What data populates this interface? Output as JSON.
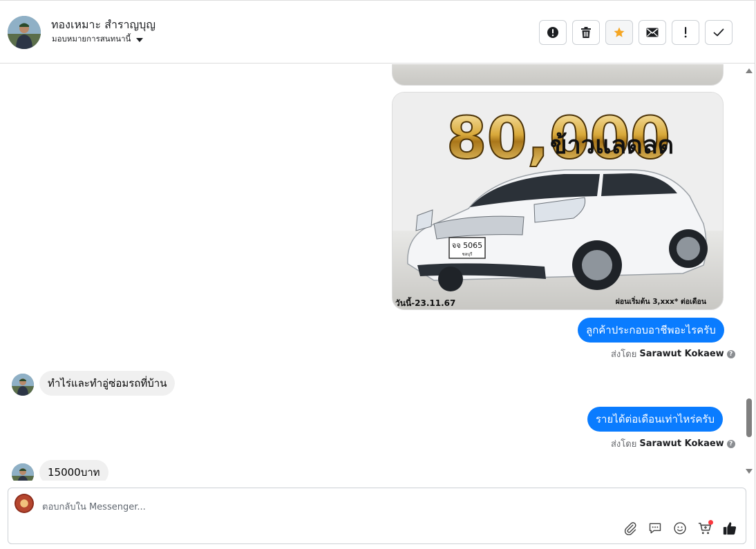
{
  "header": {
    "contact_name": "ทองเหมาะ สำราญบุญ",
    "assign_label": "มอบหมายการสนทนานี้"
  },
  "actions": [
    {
      "id": "spam",
      "icon": "alert-circle-icon"
    },
    {
      "id": "delete",
      "icon": "trash-icon"
    },
    {
      "id": "star",
      "icon": "star-icon",
      "color": "#f5a623"
    },
    {
      "id": "unread",
      "icon": "mail-icon"
    },
    {
      "id": "follow_up",
      "icon": "exclamation-icon"
    },
    {
      "id": "done",
      "icon": "check-icon"
    }
  ],
  "image_post": {
    "headline_number": "80,000",
    "headline_text": "ข้าวแลดลด",
    "plate": "จจ 5065",
    "plate_province": "ชลบุรี",
    "date_stamp": "วันนี้-23.11.67",
    "installment": "ผ่อนเริ่มต้น 3,xxx* ต่อเดือน",
    "car_color": "#f4f5f7"
  },
  "messages": [
    {
      "direction": "out",
      "text": "ลูกค้าประกอบอาชีพอะไรครับ",
      "sent_by_prefix": "ส่งโดย",
      "sender": "Sarawut Kokaew"
    },
    {
      "direction": "in",
      "text": "ทำไร่และทำอู่ซ่อมรถที่บ้าน"
    },
    {
      "direction": "out",
      "text": "รายได้ต่อเดือนเท่าไหร่ครับ",
      "sent_by_prefix": "ส่งโดย",
      "sender": "Sarawut Kokaew"
    },
    {
      "direction": "in",
      "text": "15000บาท"
    }
  ],
  "composer": {
    "placeholder": "ตอบกลับใน Messenger...",
    "tools": [
      "paperclip-icon",
      "saved-reply-icon",
      "emoji-icon",
      "cart-icon",
      "like-icon"
    ]
  },
  "colors": {
    "accent": "#0a7cff",
    "incoming_bubble": "#f0f0f0",
    "star": "#f5a623"
  }
}
